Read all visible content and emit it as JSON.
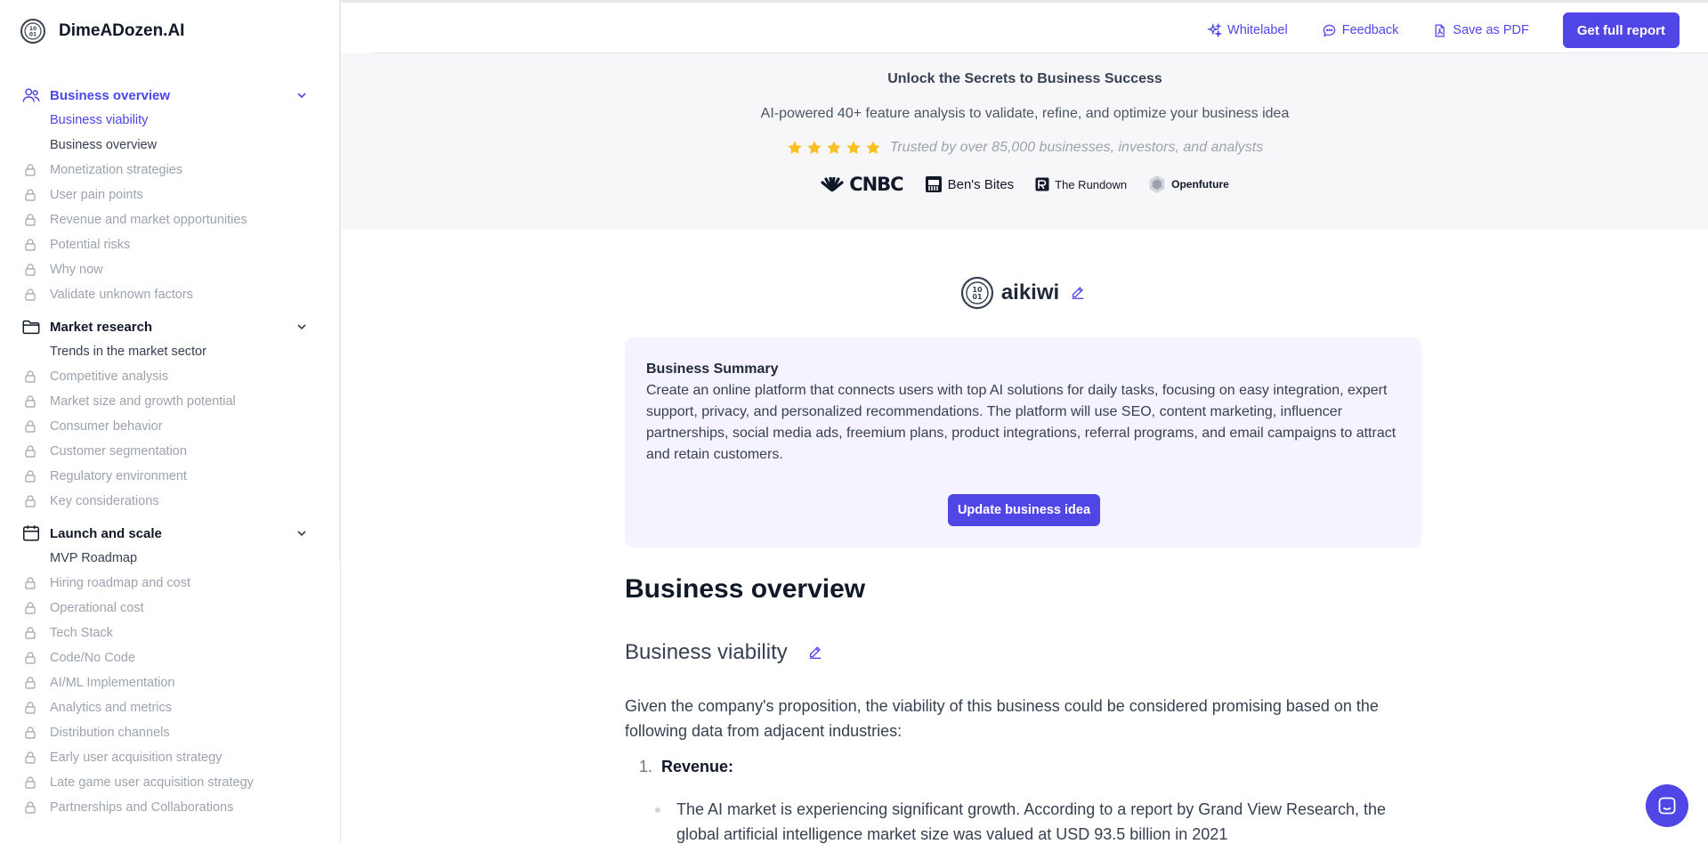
{
  "brand": {
    "name": "DimeADozen.AI"
  },
  "sidebar": {
    "groups": [
      {
        "label": "Business overview",
        "icon": "users-icon",
        "items": [
          {
            "label": "Business viability",
            "locked": false,
            "current": true
          },
          {
            "label": "Business overview",
            "locked": false,
            "current": false
          },
          {
            "label": "Monetization strategies",
            "locked": true
          },
          {
            "label": "User pain points",
            "locked": true
          },
          {
            "label": "Revenue and market opportunities",
            "locked": true
          },
          {
            "label": "Potential risks",
            "locked": true
          },
          {
            "label": "Why now",
            "locked": true
          },
          {
            "label": "Validate unknown factors",
            "locked": true
          }
        ]
      },
      {
        "label": "Market research",
        "icon": "folder-icon",
        "items": [
          {
            "label": "Trends in the market sector",
            "locked": false
          },
          {
            "label": "Competitive analysis",
            "locked": true
          },
          {
            "label": "Market size and growth potential",
            "locked": true
          },
          {
            "label": "Consumer behavior",
            "locked": true
          },
          {
            "label": "Customer segmentation",
            "locked": true
          },
          {
            "label": "Regulatory environment",
            "locked": true
          },
          {
            "label": "Key considerations",
            "locked": true
          }
        ]
      },
      {
        "label": "Launch and scale",
        "icon": "calendar-icon",
        "items": [
          {
            "label": "MVP Roadmap",
            "locked": false
          },
          {
            "label": "Hiring roadmap and cost",
            "locked": true
          },
          {
            "label": "Operational cost",
            "locked": true
          },
          {
            "label": "Tech Stack",
            "locked": true
          },
          {
            "label": "Code/No Code",
            "locked": true
          },
          {
            "label": "AI/ML Implementation",
            "locked": true
          },
          {
            "label": "Analytics and metrics",
            "locked": true
          },
          {
            "label": "Distribution channels",
            "locked": true
          },
          {
            "label": "Early user acquisition strategy",
            "locked": true
          },
          {
            "label": "Late game user acquisition strategy",
            "locked": true
          },
          {
            "label": "Partnerships and Collaborations",
            "locked": true
          }
        ]
      }
    ]
  },
  "toolbar": {
    "whitelabel": "Whitelabel",
    "feedback": "Feedback",
    "save_pdf": "Save as PDF",
    "cta": "Get full report"
  },
  "promo": {
    "title": "Unlock the Secrets to Business Success",
    "subtitle": "AI-powered 40+ feature analysis to validate, refine, and optimize your business idea",
    "trust": "Trusted by over 85,000 businesses, investors, and analysts",
    "rating": 5,
    "logos": [
      "CNBC",
      "Ben's Bites",
      "The Rundown",
      "Openfuture"
    ]
  },
  "project": {
    "name": "aikiwi"
  },
  "summary": {
    "title": "Business Summary",
    "text": "Create an online platform that connects users with top AI solutions for daily tasks, focusing on easy integration, expert support, privacy, and personalized recommendations. The platform will use SEO, content marketing, influencer partnerships, social media ads, freemium plans, product integrations, referral programs, and email campaigns to attract and retain customers.",
    "button": "Update business idea"
  },
  "report": {
    "heading": "Business overview",
    "section_title": "Business viability",
    "intro": "Given the company's proposition, the viability of this business could be considered promising based on the following data from adjacent industries:",
    "list_number": "1.",
    "list_label": "Revenue:",
    "bullet": "The AI market is experiencing significant growth. According to a report by Grand View Research, the global artificial intelligence market size was valued at USD 93.5 billion in 2021"
  },
  "colors": {
    "accent": "#4f46e5",
    "summary_bg": "#f5f3ff",
    "promo_bg": "#f7f7f9",
    "star": "#fbbf24"
  }
}
